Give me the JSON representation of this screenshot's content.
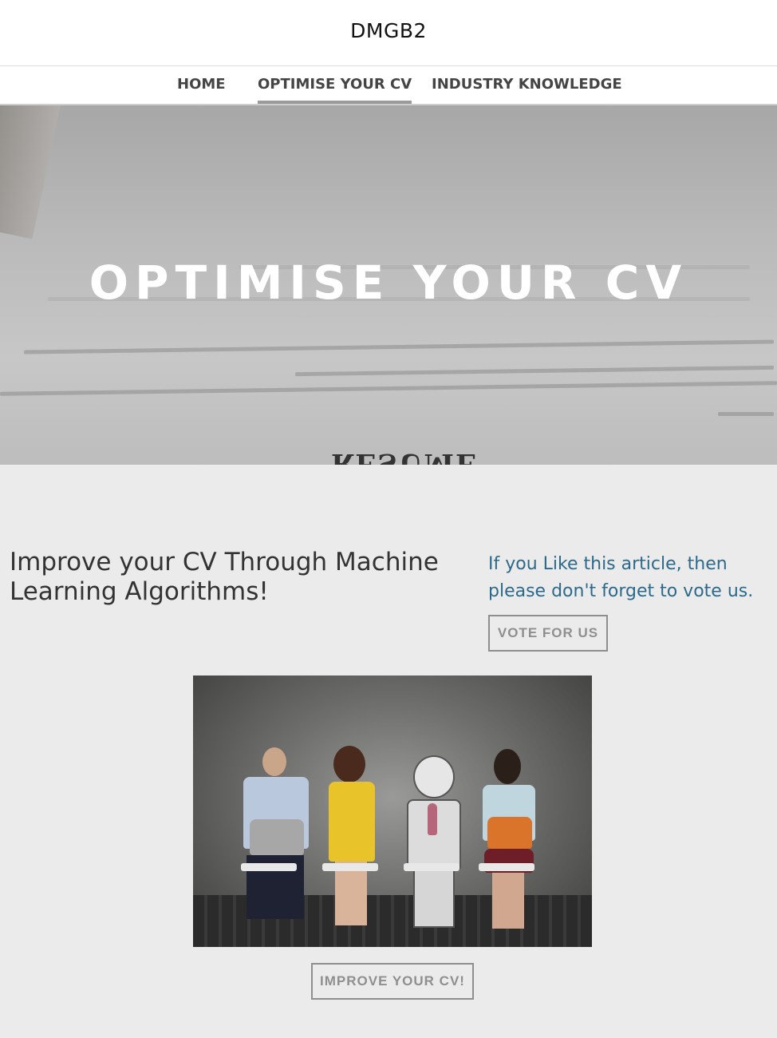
{
  "site": {
    "title": "DMGB2"
  },
  "nav": {
    "items": [
      {
        "label": "HOME"
      },
      {
        "label": "OPTIMISE YOUR CV",
        "active": true
      },
      {
        "label": "INDUSTRY KNOWLEDGE"
      }
    ]
  },
  "hero": {
    "title": "OPTIMISE YOUR CV",
    "background_word": "RESUME"
  },
  "article": {
    "heading": "Improve your CV Through Machine Learning Algorithms!"
  },
  "vote": {
    "text": "If you Like this article, then please don't forget to vote us.",
    "button_label": "VOTE FOR US"
  },
  "cta": {
    "button_label": "IMPROVE YOUR CV!"
  },
  "colors": {
    "accent_text": "#2c6a8c",
    "button_border": "#8f8f8f",
    "page_background": "#ebebeb"
  }
}
